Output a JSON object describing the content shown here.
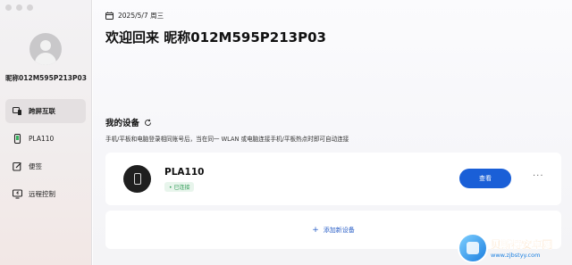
{
  "window": {
    "controls": [
      "close",
      "minimize",
      "maximize"
    ]
  },
  "sidebar": {
    "username": "昵称012M595P213P03",
    "items": [
      {
        "label": "跨屏互联",
        "icon": "cross-screen-icon",
        "active": true
      },
      {
        "label": "PLA110",
        "icon": "phone-icon",
        "active": false
      },
      {
        "label": "便签",
        "icon": "note-icon",
        "active": false
      },
      {
        "label": "远程控制",
        "icon": "remote-control-icon",
        "active": false
      }
    ]
  },
  "header": {
    "date": "2025/5/7 周三",
    "welcome": "欢迎回来 昵称012M595P213P03"
  },
  "devices": {
    "title": "我的设备",
    "description": "手机/平板和电脑登录相同账号后，当在同一 WLAN 或电脑连接手机/平板热点时即可自动连接",
    "list": [
      {
        "name": "PLA110",
        "status": "• 已连接",
        "action": "查看",
        "more": "···"
      }
    ],
    "add_label": "添加新设备",
    "add_icon": "+"
  },
  "watermark": {
    "title": "贝斯特安卓网",
    "url": "www.zjbstyy.com"
  },
  "colors": {
    "accent": "#1a5fd7",
    "status_green": "#2e9a55",
    "watermark_orange": "#f08a1c"
  }
}
